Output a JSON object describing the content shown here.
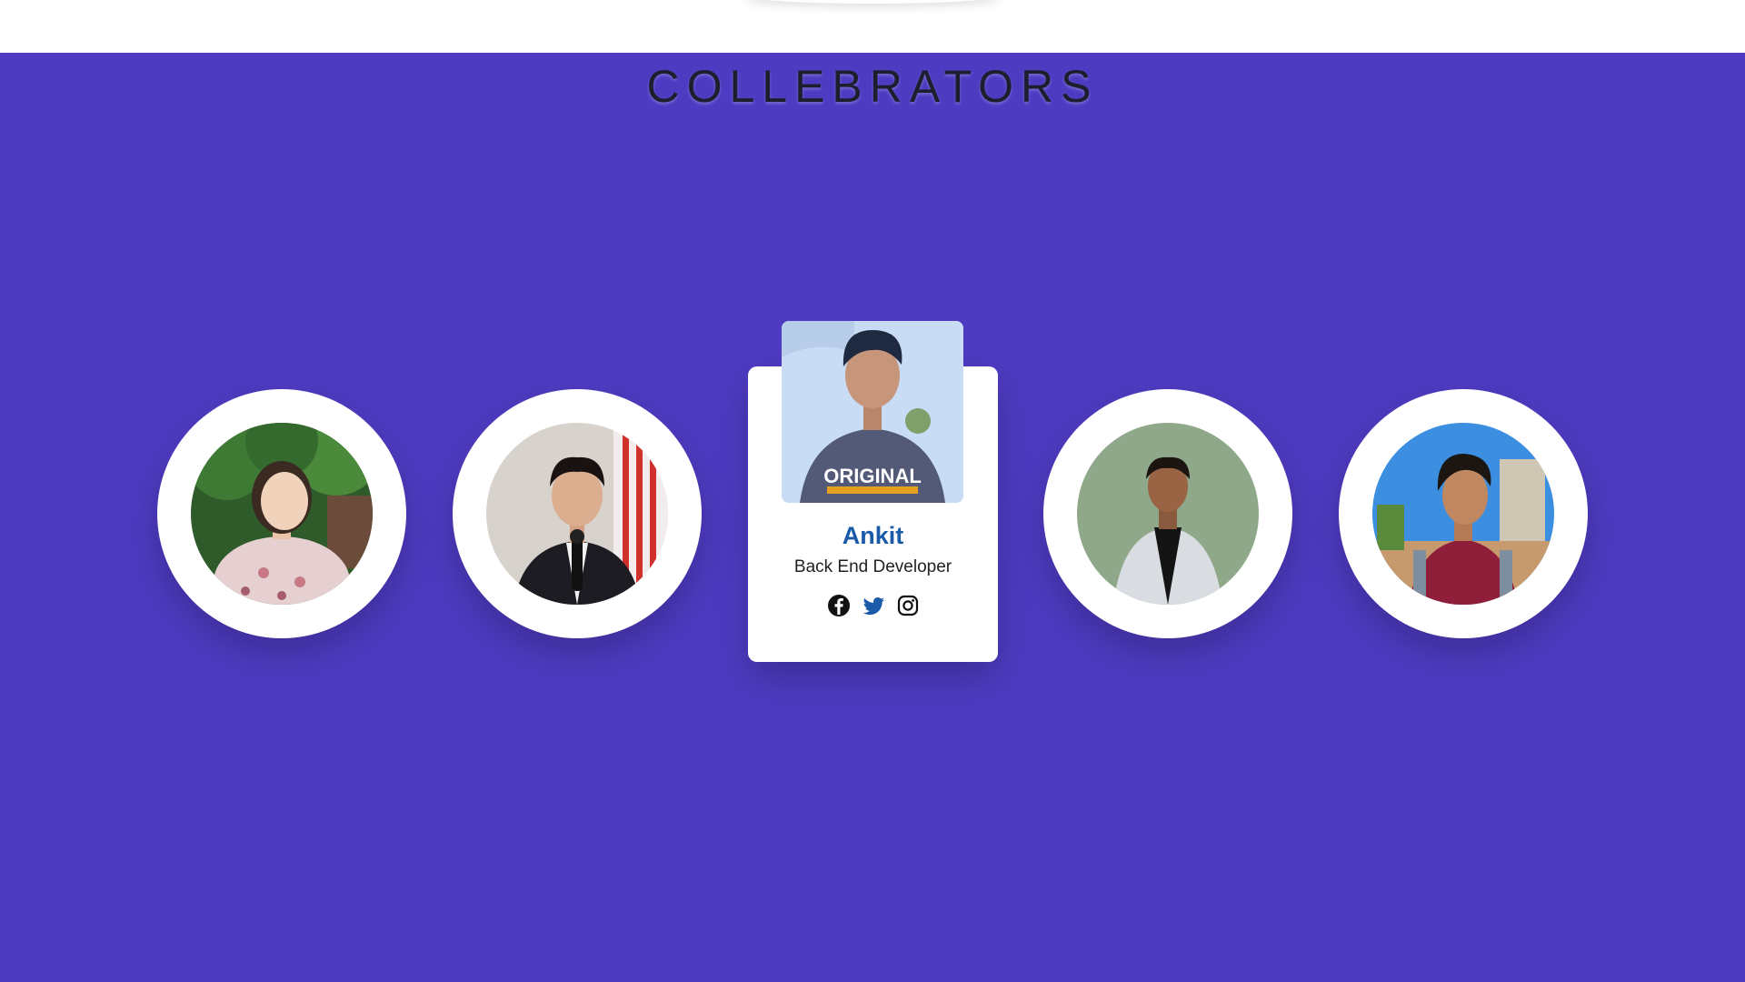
{
  "section": {
    "title": "COLLEBRATORS",
    "background_color": "#4e3bc2"
  },
  "active_member": {
    "name": "Ankit",
    "role": "Back End Developer",
    "shirt_text": "ORIGINAL",
    "name_color": "#1a5aa8"
  },
  "members": [
    {
      "photo": "avatar-woman-floral-shirt"
    },
    {
      "photo": "avatar-man-suit-microphone"
    },
    {
      "photo": "avatar-man-white-jacket"
    },
    {
      "photo": "avatar-man-backpack-outdoor"
    }
  ],
  "social_icons": [
    "facebook-icon",
    "twitter-icon",
    "instagram-icon"
  ]
}
